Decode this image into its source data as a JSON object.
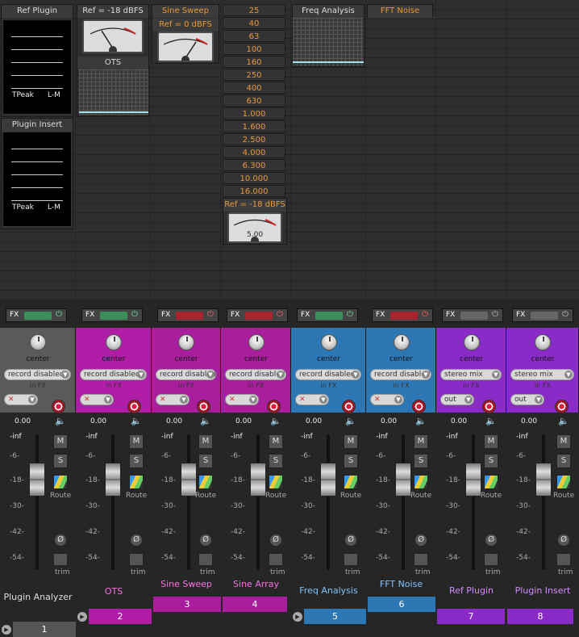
{
  "panels": {
    "ref_plugin_title": "Ref Plugin",
    "plugin_insert_title": "Plugin Insert",
    "meter_tpeak": "TPeak",
    "meter_lm": "L-M",
    "ots_ref": "Ref = -18 dBFS",
    "ots_title": "OTS",
    "sine_sweep_title": "Sine Sweep",
    "sine_sweep_ref": "Ref = 0 dBFS",
    "sine_array_ref": "Ref = -18 dBFS",
    "sine_array_vu_value": "5.00",
    "freq_analysis_title": "Freq Analysis",
    "fft_noise_title": "FFT Noise"
  },
  "bands": [
    "25",
    "40",
    "63",
    "100",
    "160",
    "250",
    "400",
    "630",
    "1.000",
    "1.600",
    "2.500",
    "4.000",
    "6.300",
    "10.000",
    "16.000"
  ],
  "common": {
    "pan_label": "center",
    "in_fx_label": "in FX",
    "fx_label": "FX",
    "power_icon": "⏻",
    "volume_readout": "0.00",
    "db_scale": [
      "-inf",
      "-6-",
      "-18-",
      "-30-",
      "-42-",
      "-54-"
    ],
    "mute_label": "M",
    "solo_label": "S",
    "route_label": "Route",
    "trim_label": "trim",
    "phase_symbol": "Ø",
    "speaker_icon": "🔈",
    "disabled_x": "✕"
  },
  "tracks": [
    {
      "name": "Plugin Analyzer",
      "number": "1",
      "color": "#5a5a5a",
      "input": "record disabled",
      "output": "",
      "fx_state": "on",
      "name_color": "#dddddd"
    },
    {
      "name": "OTS",
      "number": "2",
      "color": "#b01ea8",
      "input": "record disabled",
      "output": "",
      "fx_state": "on",
      "name_color": "#ff6fe8"
    },
    {
      "name": "Sine Sweep",
      "number": "3",
      "color": "#a81e9c",
      "input": "record disabled",
      "output": "",
      "fx_state": "off-red",
      "name_color": "#ff6fe8"
    },
    {
      "name": "Sine Array",
      "number": "4",
      "color": "#a81e9c",
      "input": "record disabled",
      "output": "",
      "fx_state": "off-red",
      "name_color": "#ff6fe8"
    },
    {
      "name": "Freq Analysis",
      "number": "5",
      "color": "#2d77b4",
      "input": "record disabled",
      "output": "",
      "fx_state": "on",
      "name_color": "#7fc4ff"
    },
    {
      "name": "FFT Noise",
      "number": "6",
      "color": "#2d77b4",
      "input": "record disabled",
      "output": "",
      "fx_state": "off-red",
      "name_color": "#7fc4ff"
    },
    {
      "name": "Ref Plugin",
      "number": "7",
      "color": "#8a2bc8",
      "input": "stereo mix",
      "output": "out",
      "fx_state": "bypass",
      "name_color": "#d48cff"
    },
    {
      "name": "Plugin Insert",
      "number": "8",
      "color": "#8a2bc8",
      "input": "stereo mix",
      "output": "out",
      "fx_state": "bypass",
      "name_color": "#d48cff"
    }
  ],
  "colors": {
    "fx_on": "#3a8f5a",
    "fx_off": "#a8242e",
    "fx_bypass": "#666666"
  }
}
